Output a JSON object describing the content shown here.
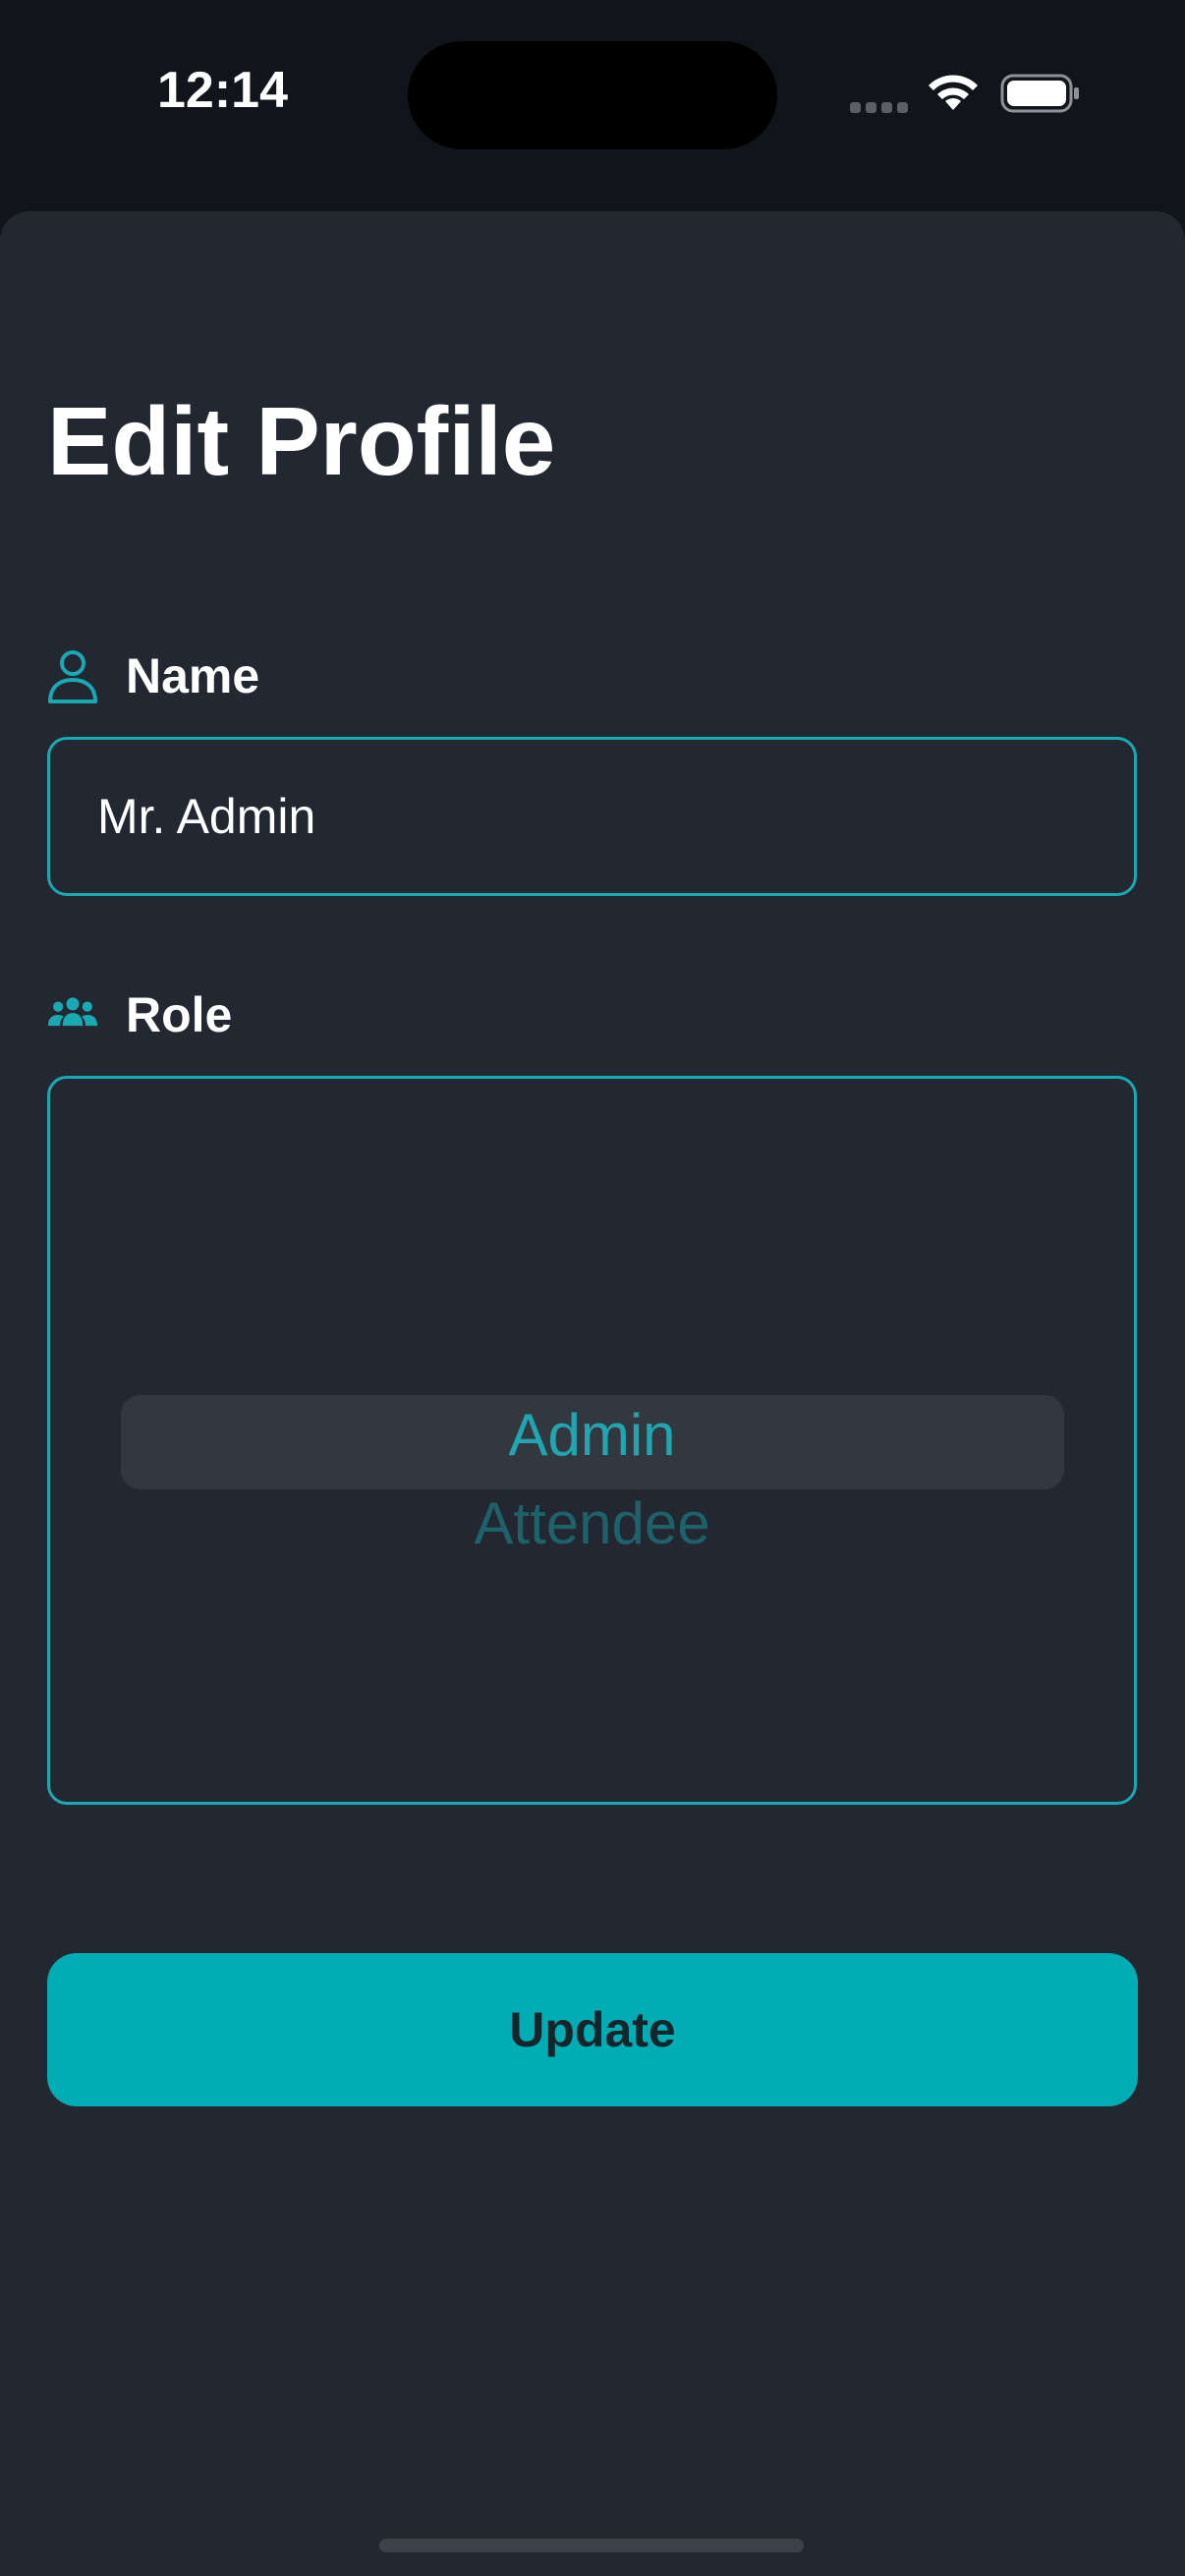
{
  "status_bar": {
    "time": "12:14",
    "signal_icon": "cellular-signal-icon",
    "wifi_icon": "wifi-icon",
    "battery_icon": "battery-icon"
  },
  "page": {
    "title": "Edit Profile"
  },
  "name_field": {
    "icon": "person-icon",
    "label": "Name",
    "value": "Mr. Admin"
  },
  "role_field": {
    "icon": "people-group-icon",
    "label": "Role",
    "options": [
      "Admin",
      "Attendee"
    ],
    "selected": "Admin"
  },
  "actions": {
    "update_label": "Update"
  },
  "colors": {
    "accent": "#00adb5",
    "background": "#222731",
    "status_bar_bg": "#111519",
    "text_primary": "#ffffff"
  }
}
